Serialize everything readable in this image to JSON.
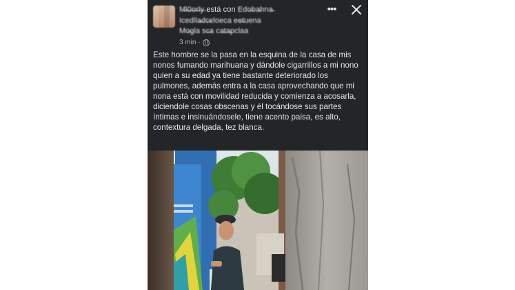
{
  "post": {
    "author": "M̶l̶0̶o̶r̶l̶y̶",
    "author_suffix": "está con",
    "tagged_first": "Edo̶ba̶hna̶",
    "tagged_line1": "Icedlla̶dc̶eloeca ee̶tuena",
    "tagged_line2": "Mo̶gla sc̶a ca̶ta̶pclaa",
    "time": "3 min ·",
    "icons": {
      "more": "more-horizontal-icon",
      "close": "close-icon",
      "privacy": "globe-icon"
    },
    "text": "Este hombre se la pasa en la esquina de la casa de mis nonos fumando marihuana y dándole cigarrillos a mi nono quien a su edad ya tiene bastante deteriorado los pulmones, además entra a la casa aprovechando que mi nona está con movilidad reducida y comienza a acosarla, diciendole cosas obscenas y él tocándose sus partes íntimas e insinuándosele, tiene acento paisa, es alto, contextura delgada, tez blanca."
  },
  "colors": {
    "background": "#242526",
    "text": "#e4e6eb",
    "secondary": "#b0b3b8"
  }
}
